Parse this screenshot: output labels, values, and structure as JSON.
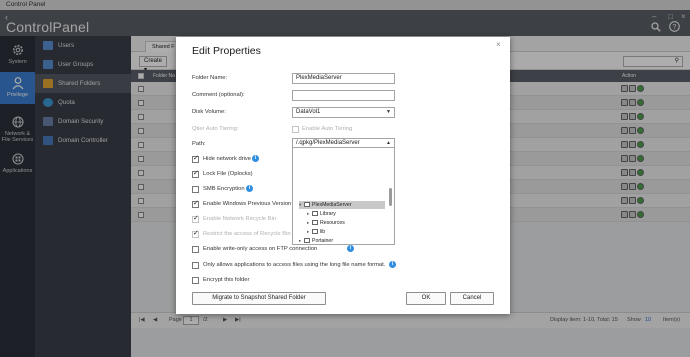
{
  "window": {
    "title": "Control Panel"
  },
  "header": {
    "app_name_light": "Control",
    "app_name_bold": "Panel"
  },
  "rail": [
    {
      "label": "System",
      "icon": "gear-icon"
    },
    {
      "label": "Privilege",
      "icon": "user-icon",
      "active": true
    },
    {
      "label": "Network & File Services",
      "icon": "globe-icon"
    },
    {
      "label": "Applications",
      "icon": "apps-icon"
    }
  ],
  "submenu": [
    {
      "label": "Users",
      "color": "#5b8fd3"
    },
    {
      "label": "User Groups",
      "color": "#5b8fd3"
    },
    {
      "label": "Shared Folders",
      "color": "#e3a734",
      "active": true
    },
    {
      "label": "Quota",
      "color": "#3d9bd6"
    },
    {
      "label": "Domain Security",
      "color": "#6b7fa7"
    },
    {
      "label": "Domain Controller",
      "color": "#4a7bc0"
    }
  ],
  "main": {
    "tab_label": "Shared F",
    "create_label": "Create",
    "grid_header": {
      "folder": "Folder Na",
      "action": "Action"
    },
    "pager": {
      "page_label": "Page",
      "page_value": "1",
      "page_total": "/2",
      "display_info": "Display item: 1-10, Total: 15",
      "show_label": "Show",
      "show_value": "10",
      "items_label": "Item(s)"
    }
  },
  "dialog": {
    "title": "Edit Properties",
    "close_icon": "close-icon",
    "fields": {
      "folder_name_label": "Folder Name:",
      "folder_name_value": "PlexMediaServer",
      "comment_label": "Comment (optional):",
      "comment_value": "",
      "disk_volume_label": "Disk Volume:",
      "disk_volume_value": "DataVol1",
      "qtier_label": "Qtier Auto Tiering:",
      "qtier_option": "Enable Auto Tiering",
      "path_label": "Path:",
      "path_value": "/.qpkg/PlexMediaServer"
    },
    "tree": {
      "selected": "PlexMediaServer",
      "children": [
        "Library",
        "Resources",
        "lib"
      ],
      "sibling": "Portainer"
    },
    "options": [
      {
        "label": "Hide network drive",
        "checked": true,
        "info": true
      },
      {
        "label": "Lock File (Oplocks)",
        "checked": true,
        "info": false
      },
      {
        "label": "SMB Encryption",
        "checked": false,
        "info": true
      },
      {
        "label": "Enable Windows Previous Versions",
        "checked": true,
        "info": false
      },
      {
        "label": "Enable Network Recycle Bin",
        "checked": true,
        "disabled": true
      },
      {
        "label": "Restrict the access of Recycle Bin",
        "checked": true,
        "disabled": true
      },
      {
        "label": "Enable write-only access on FTP connection",
        "checked": false,
        "info": true
      },
      {
        "label": "Only allows applications to access files using the long file name format.",
        "checked": false,
        "info": true
      },
      {
        "label": "Encrypt this folder",
        "checked": false,
        "info": false
      }
    ],
    "buttons": {
      "migrate": "Migrate to Snapshot Shared Folder",
      "ok": "OK",
      "cancel": "Cancel"
    }
  },
  "colors": {
    "accent": "#3d7ed1",
    "info": "#2f8ee0",
    "header": "#5a5f67"
  }
}
